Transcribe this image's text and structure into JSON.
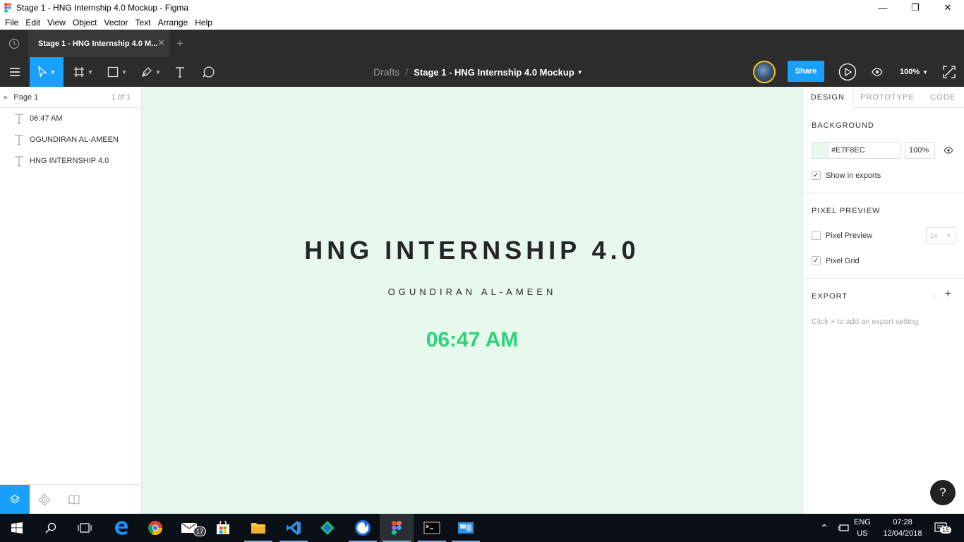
{
  "window": {
    "title": "Stage 1 - HNG Internship 4.0 Mockup - Figma"
  },
  "menu": [
    "File",
    "Edit",
    "View",
    "Object",
    "Vector",
    "Text",
    "Arrange",
    "Help"
  ],
  "tab": {
    "label": "Stage 1 - HNG Internship 4.0 M..."
  },
  "breadcrumb": {
    "root": "Drafts",
    "separator": "/",
    "file": "Stage 1 - HNG Internship 4.0 Mockup"
  },
  "toolbar": {
    "share_label": "Share",
    "zoom": "100%"
  },
  "pages": {
    "current": "Page 1",
    "count": "1 of 1"
  },
  "layers": [
    {
      "label": "06:47 AM"
    },
    {
      "label": "OGUNDIRAN AL-AMEEN"
    },
    {
      "label": "HNG INTERNSHIP 4.0"
    }
  ],
  "canvas": {
    "background": "#E7F8EC",
    "title": "HNG INTERNSHIP 4.0",
    "name": "OGUNDIRAN AL-AMEEN",
    "time": "06:47 AM",
    "time_color": "#2fd27b"
  },
  "right_panel": {
    "tabs": [
      "DESIGN",
      "PROTOTYPE",
      "CODE"
    ],
    "background": {
      "title": "BACKGROUND",
      "hex": "#E7F8EC",
      "opacity": "100%",
      "show_in_exports": "Show in exports",
      "show_in_exports_checked": true
    },
    "pixel_preview": {
      "title": "PIXEL PREVIEW",
      "preview_label": "Pixel Preview",
      "preview_checked": false,
      "scale": "1x",
      "grid_label": "Pixel Grid",
      "grid_checked": true
    },
    "export": {
      "title": "EXPORT",
      "hint": "Click + to add an export setting"
    }
  },
  "help": {
    "label": "?"
  },
  "taskbar": {
    "mail_badge": "17",
    "language": {
      "line1": "ENG",
      "line2": "US"
    },
    "clock": {
      "time": "07:28",
      "date": "12/04/2018"
    },
    "notifications": "15"
  },
  "colors": {
    "accent": "#18a0fb",
    "toolbar": "#2c2c2c",
    "canvas": "#e7f8ec"
  }
}
